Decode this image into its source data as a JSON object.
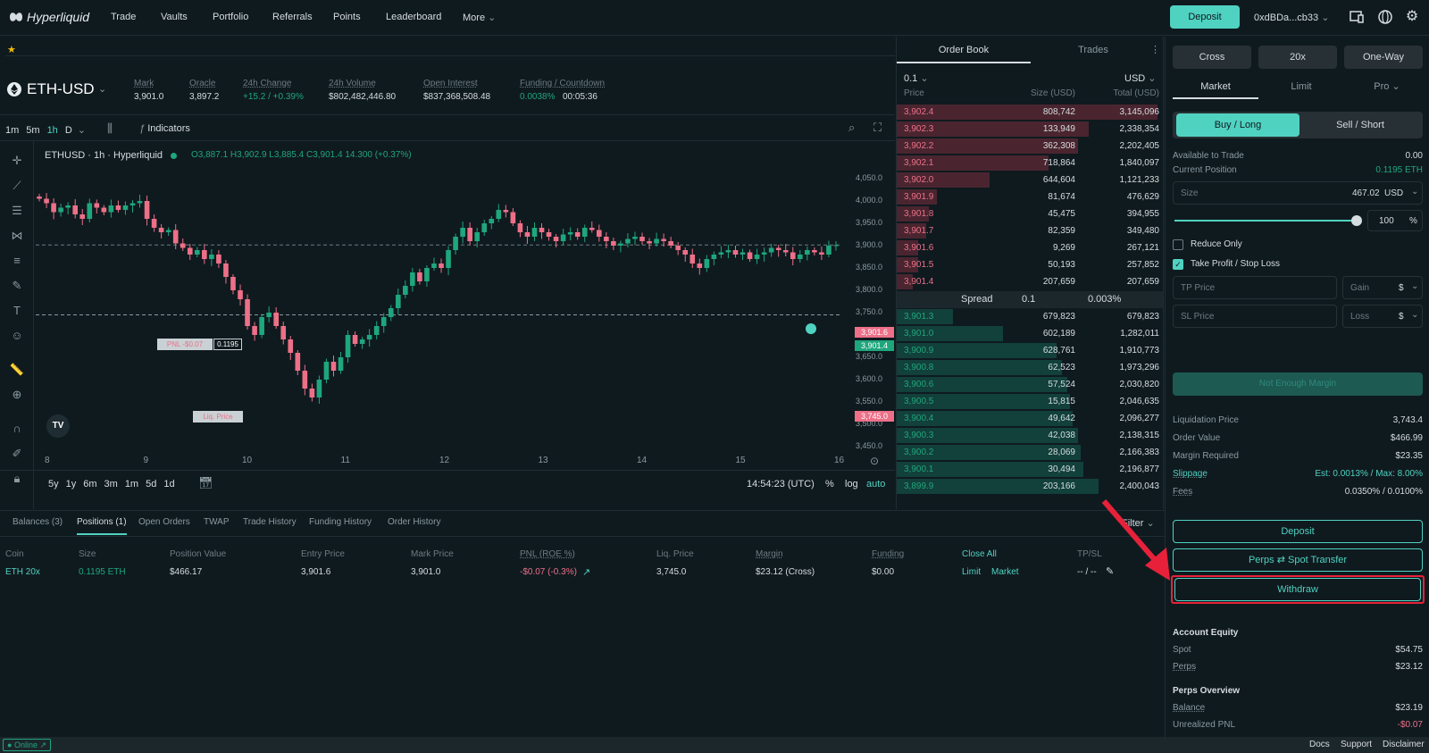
{
  "app": {
    "logo": "Hyperliquid"
  },
  "nav": {
    "items": [
      "Trade",
      "Vaults",
      "Portfolio",
      "Referrals",
      "Points",
      "Leaderboard",
      "More"
    ],
    "deposit": "Deposit",
    "wallet": "0xdBDa...cb33"
  },
  "market": {
    "symbol": "ETH-USD",
    "stats": [
      {
        "label": "Mark",
        "value": "3,901.0"
      },
      {
        "label": "Oracle",
        "value": "3,897.2"
      },
      {
        "label": "24h Change",
        "value": "+15.2 / +0.39%"
      },
      {
        "label": "24h Volume",
        "value": "$802,482,446.80"
      },
      {
        "label": "Open Interest",
        "value": "$837,368,508.48"
      },
      {
        "label": "Funding / Countdown",
        "value": "0.0038%",
        "countdown": "00:05:36"
      }
    ]
  },
  "chart": {
    "intervals": [
      "1m",
      "5m",
      "1h",
      "D"
    ],
    "indicators": "Indicators",
    "legend_title": "ETHUSD · 1h · Hyperliquid",
    "ohlc": "O3,887.1 H3,902.9 L3,885.4 C3,901.4 14.300 (+0.37%)",
    "price_ticks": [
      "4,050.0",
      "4,000.0",
      "3,950.0",
      "3,900.0",
      "3,850.0",
      "3,800.0",
      "3,750.0",
      "3,700.0",
      "3,650.0",
      "3,600.0",
      "3,550.0",
      "3,500.0",
      "3,450.0"
    ],
    "date_ticks": [
      "8",
      "9",
      "10",
      "11",
      "12",
      "13",
      "14",
      "15",
      "16"
    ],
    "tags": {
      "ask": "3,901.6",
      "bid": "3,901.4",
      "liq": "3,745.0"
    },
    "pnl_label": "PNL -$0.07",
    "size_tag": "0.1195",
    "liq_label": "Liq. Price",
    "ranges": [
      "5y",
      "1y",
      "6m",
      "3m",
      "1m",
      "5d",
      "1d"
    ],
    "time": "14:54:23 (UTC)",
    "opts": [
      "%",
      "log",
      "auto"
    ],
    "closes": [
      4005,
      3995,
      3975,
      3985,
      3990,
      3970,
      3960,
      3995,
      3985,
      3975,
      3990,
      3980,
      3990,
      3995,
      4000,
      3960,
      3940,
      3930,
      3935,
      3905,
      3895,
      3880,
      3890,
      3870,
      3880,
      3860,
      3830,
      3800,
      3780,
      3720,
      3700,
      3740,
      3750,
      3720,
      3690,
      3660,
      3620,
      3580,
      3560,
      3600,
      3640,
      3620,
      3650,
      3700,
      3680,
      3690,
      3700,
      3720,
      3740,
      3760,
      3790,
      3810,
      3840,
      3820,
      3850,
      3860,
      3850,
      3890,
      3920,
      3940,
      3910,
      3930,
      3950,
      3960,
      3980,
      3975,
      3950,
      3930,
      3920,
      3940,
      3930,
      3920,
      3910,
      3925,
      3930,
      3920,
      3940,
      3935,
      3920,
      3910,
      3900,
      3905,
      3915,
      3920,
      3910,
      3905,
      3915,
      3910,
      3900,
      3890,
      3880,
      3860,
      3850,
      3870,
      3880,
      3885,
      3890,
      3880,
      3885,
      3870,
      3880,
      3885,
      3895,
      3890,
      3885,
      3870,
      3880,
      3890,
      3885,
      3880,
      3900,
      3901
    ]
  },
  "orderbook": {
    "tabs": [
      "Order Book",
      "Trades"
    ],
    "tick": "0.1",
    "unit": "USD",
    "headers": [
      "Price",
      "Size (USD)",
      "Total (USD)"
    ],
    "asks": [
      {
        "p": "3,902.4",
        "s": "808,742",
        "t": "3,145,096",
        "d": 0.98
      },
      {
        "p": "3,902.3",
        "s": "133,949",
        "t": "2,338,354",
        "d": 0.72
      },
      {
        "p": "3,902.2",
        "s": "362,308",
        "t": "2,202,405",
        "d": 0.68
      },
      {
        "p": "3,902.1",
        "s": "718,864",
        "t": "1,840,097",
        "d": 0.57
      },
      {
        "p": "3,902.0",
        "s": "644,604",
        "t": "1,121,233",
        "d": 0.35
      },
      {
        "p": "3,901.9",
        "s": "81,674",
        "t": "476,629",
        "d": 0.15
      },
      {
        "p": "3,901.8",
        "s": "45,475",
        "t": "394,955",
        "d": 0.12
      },
      {
        "p": "3,901.7",
        "s": "82,359",
        "t": "349,480",
        "d": 0.11
      },
      {
        "p": "3,901.6",
        "s": "9,269",
        "t": "267,121",
        "d": 0.08
      },
      {
        "p": "3,901.5",
        "s": "50,193",
        "t": "257,852",
        "d": 0.08
      },
      {
        "p": "3,901.4",
        "s": "207,659",
        "t": "207,659",
        "d": 0.06
      }
    ],
    "spread": {
      "label": "Spread",
      "value": "0.1",
      "pct": "0.003%"
    },
    "bids": [
      {
        "p": "3,901.3",
        "s": "679,823",
        "t": "679,823",
        "d": 0.21
      },
      {
        "p": "3,901.0",
        "s": "602,189",
        "t": "1,282,011",
        "d": 0.4
      },
      {
        "p": "3,900.9",
        "s": "628,761",
        "t": "1,910,773",
        "d": 0.6
      },
      {
        "p": "3,900.8",
        "s": "62,523",
        "t": "1,973,296",
        "d": 0.62
      },
      {
        "p": "3,900.6",
        "s": "57,524",
        "t": "2,030,820",
        "d": 0.64
      },
      {
        "p": "3,900.5",
        "s": "15,815",
        "t": "2,046,635",
        "d": 0.65
      },
      {
        "p": "3,900.4",
        "s": "49,642",
        "t": "2,096,277",
        "d": 0.66
      },
      {
        "p": "3,900.3",
        "s": "42,038",
        "t": "2,138,315",
        "d": 0.68
      },
      {
        "p": "3,900.2",
        "s": "28,069",
        "t": "2,166,383",
        "d": 0.69
      },
      {
        "p": "3,900.1",
        "s": "30,494",
        "t": "2,196,877",
        "d": 0.7
      },
      {
        "p": "3,899.9",
        "s": "203,166",
        "t": "2,400,043",
        "d": 0.76
      }
    ]
  },
  "bottom": {
    "tabs": [
      "Balances (3)",
      "Positions (1)",
      "Open Orders",
      "TWAP",
      "Trade History",
      "Funding History",
      "Order History"
    ],
    "filter": "Filter",
    "headers": [
      "Coin",
      "Size",
      "Position Value",
      "Entry Price",
      "Mark Price",
      "PNL (ROE %)",
      "Liq. Price",
      "Margin",
      "Funding",
      "Close All",
      "TP/SL"
    ],
    "row": {
      "coin": "ETH 20x",
      "size": "0.1195 ETH",
      "value": "$466.17",
      "entry": "3,901.6",
      "mark": "3,901.0",
      "pnl": "-$0.07 (-0.3%)",
      "liq": "3,745.0",
      "margin": "$23.12 (Cross)",
      "funding": "$0.00",
      "limit": "Limit",
      "market": "Market",
      "tpsl": "-- / --"
    }
  },
  "trade": {
    "cross": "Cross",
    "lev": "20x",
    "mode": "One-Way",
    "types": [
      "Market",
      "Limit",
      "Pro"
    ],
    "buy": "Buy / Long",
    "sell": "Sell / Short",
    "avail_label": "Available to Trade",
    "avail": "0.00",
    "pos_label": "Current Position",
    "pos": "0.1195 ETH",
    "size_label": "Size",
    "size_val": "467.02",
    "size_unit": "USD",
    "pct": "100",
    "pct_sym": "%",
    "slider": 1.0,
    "reduce": "Reduce Only",
    "tpsl": "Take Profit / Stop Loss",
    "tp": "TP Price",
    "gain": "Gain",
    "sl": "SL Price",
    "loss": "Loss",
    "cur": "$",
    "submit": "Not Enough Margin",
    "info": [
      {
        "k": "Liquidation Price",
        "v": "3,743.4"
      },
      {
        "k": "Order Value",
        "v": "$466.99"
      },
      {
        "k": "Margin Required",
        "v": "$23.35"
      },
      {
        "k": "Slippage",
        "v": "Est: 0.0013% / Max: 8.00%"
      },
      {
        "k": "Fees",
        "v": "0.0350% / 0.0100%"
      }
    ],
    "deposit": "Deposit",
    "transfer": "Perps ⇄ Spot Transfer",
    "withdraw": "Withdraw",
    "equity_title": "Account Equity",
    "spot": "Spot",
    "spot_v": "$54.75",
    "perps": "Perps",
    "perps_v": "$23.12",
    "overview": "Perps Overview",
    "balance": "Balance",
    "balance_v": "$23.19",
    "upnl": "Unrealized PNL",
    "upnl_v": "-$0.07"
  },
  "footer": {
    "online": "Online",
    "links": [
      "Docs",
      "Support",
      "Disclaimer"
    ]
  },
  "colors": {
    "accent": "#50d2c1",
    "up": "#1fa67d",
    "down": "#ed7088",
    "bg": "#0f1a1f",
    "highlight": "#e8213a"
  }
}
